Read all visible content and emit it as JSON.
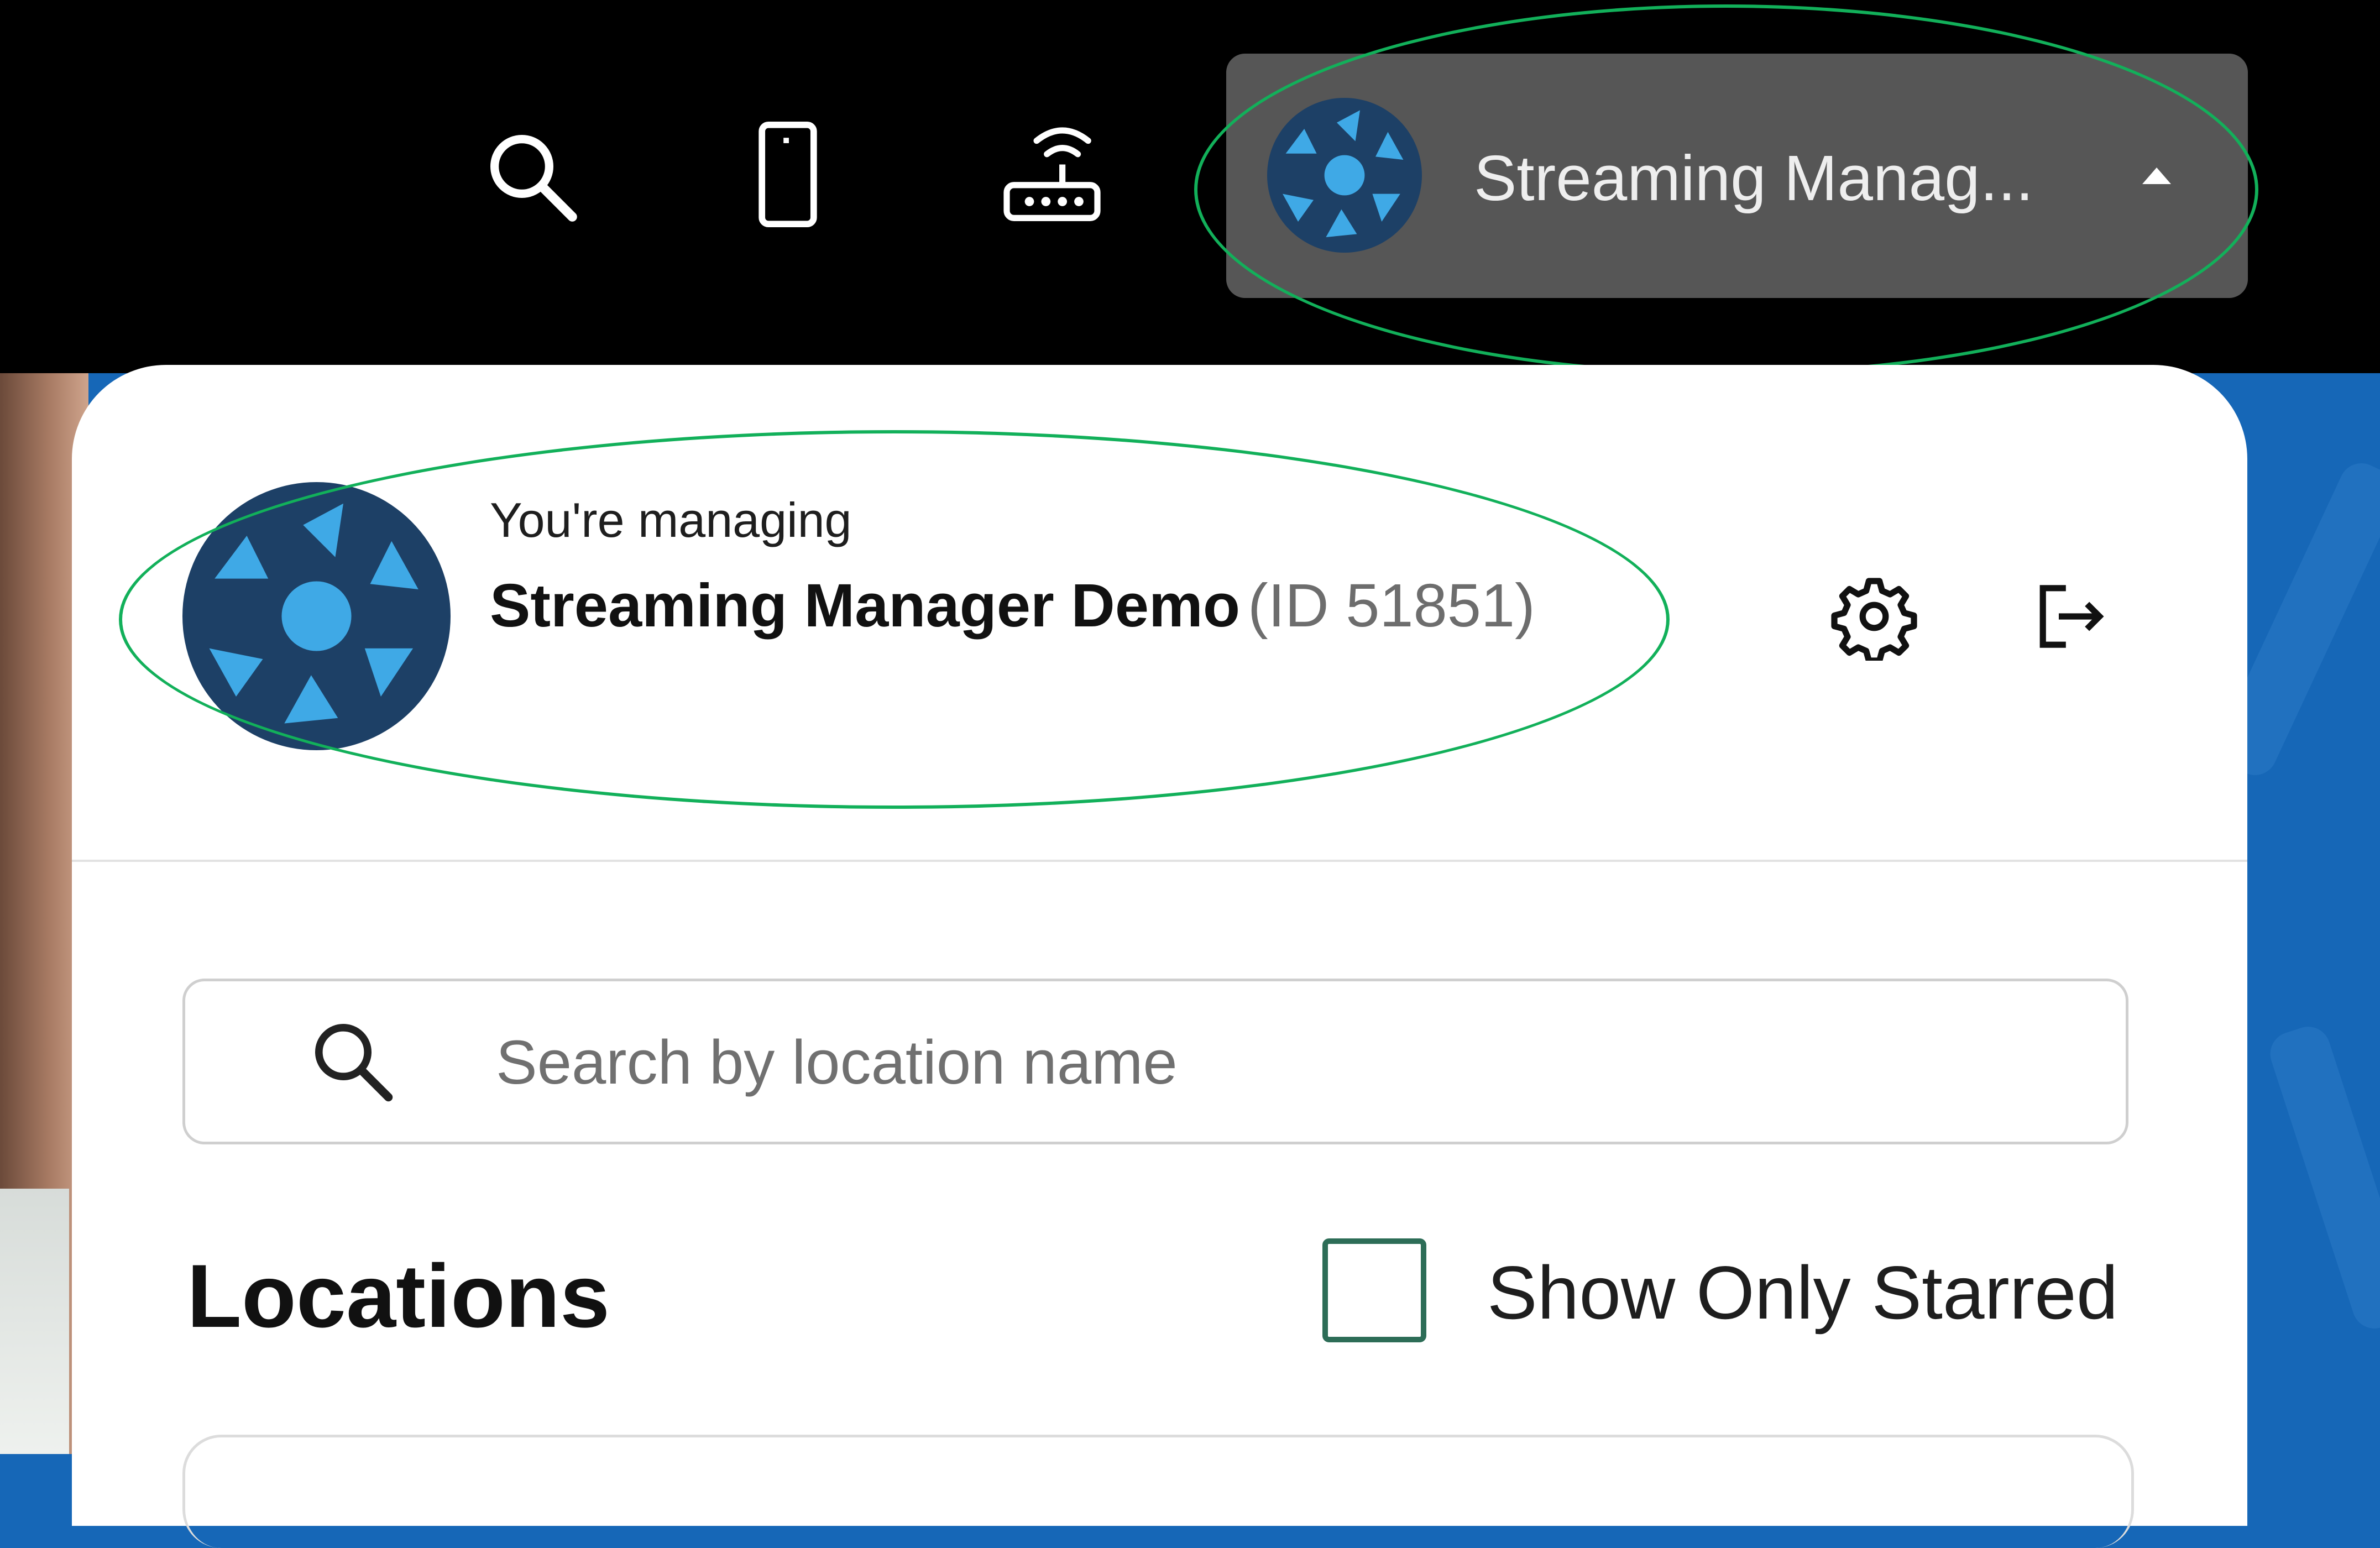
{
  "topbar": {
    "icons": [
      "search-icon",
      "phone-icon",
      "router-icon"
    ],
    "account_button": {
      "name": "Streaming Manag...",
      "expanded": true
    }
  },
  "panel": {
    "label": "You're managing",
    "org_name": "Streaming Manager Demo",
    "org_id": "(ID 51851)",
    "icons": [
      "settings-gear-icon",
      "logout-icon"
    ]
  },
  "search": {
    "placeholder": "Search by location name"
  },
  "locations": {
    "title": "Locations",
    "show_only_starred_label": "Show Only Starred",
    "show_only_starred_checked": false
  },
  "colors": {
    "topbar": "#000000",
    "account_button": "#565656",
    "background": "#1667b7",
    "avatar_dark": "#1d4066",
    "avatar_accent": "#3fa9e6",
    "highlight_ring": "#12b05a",
    "checkbox_border": "#2d6d57"
  }
}
